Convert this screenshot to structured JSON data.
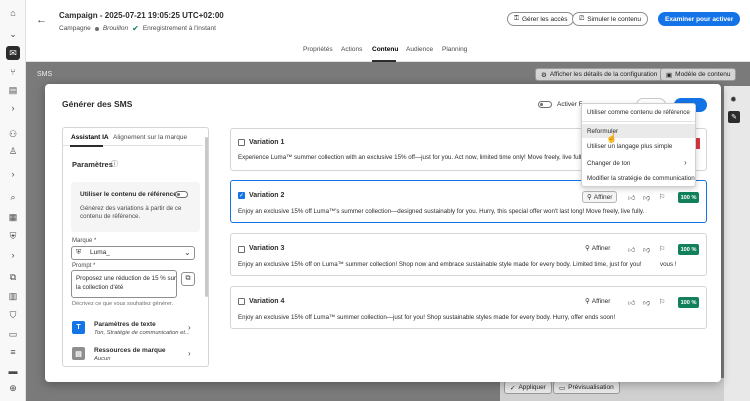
{
  "rail": {
    "icons": [
      "home-icon",
      "chevron-down-icon",
      "campaign-icon",
      "journey-icon",
      "content-icon",
      "chevron-right-icon",
      "audience-icon",
      "profile-icon",
      "chevron-right-icon",
      "schema-icon",
      "governance-icon",
      "datasets-icon",
      "queries-icon",
      "sources-icon",
      "policies-icon",
      "layers-icon",
      "monitoring-icon",
      "settings-icon"
    ]
  },
  "header": {
    "title": "Campaign - 2025-07-21 19:05:25 UTC+02:00",
    "type": "Campagne",
    "status": "Brouillon",
    "save_status": "Enregistrement à l'instant",
    "manage_access": "Gérer les accès",
    "simulate": "Simuler le contenu",
    "review_activate": "Examiner pour activer"
  },
  "tabs": [
    "Propriétés",
    "Actions",
    "Contenu",
    "Audience",
    "Planning"
  ],
  "active_tab": "Contenu",
  "channel_bar": {
    "label": "SMS",
    "show_config": "Afficher les détails de la configuration",
    "content_template": "Modèle de contenu"
  },
  "modal": {
    "title": "Générer des SMS",
    "toggle_label": "Activer F",
    "left_tabs": [
      "Assistant IA",
      "Alignement sur la marque"
    ],
    "params_title": "Paramètres",
    "use_ref_title": "Utiliser le contenu de référence",
    "use_ref_desc1": "Générez des variations à partir de ce",
    "use_ref_desc2": "contenu de référence.",
    "brand_label": "Marque *",
    "brand_value": "Luma_",
    "prompt_label": "Prompt *",
    "prompt_line1": "Proposez une réduction de 15 % sur",
    "prompt_line2": "la collection d'été",
    "prompt_hint": "Décrivez ce que vous souhaitez générer.",
    "text_params_title": "Paramètres de texte",
    "text_params_sub": "Ton, Stratégie de communication et...",
    "brand_res_title": "Ressources de marque",
    "brand_res_sub": "Aucun"
  },
  "variations": [
    {
      "title": "Variation 1",
      "text": "Experience Luma™ summer collection with an exclusive 15% off—just for you. Act now, limited time only! Move freely, live fully.",
      "checked": false,
      "score": "100 %"
    },
    {
      "title": "Variation 2",
      "text": "Enjoy an exclusive 15% off Luma™'s summer collection—designed sustainably for you. Hurry, this special offer won't last long! Move freely, live fully.",
      "checked": true,
      "score": "100 %"
    },
    {
      "title": "Variation 3",
      "text": "Enjoy an exclusive 15% off on Luma™ summer collection! Shop now and embrace sustainable style made for every body. Limited time, just for you!",
      "text_tail": "vous !",
      "checked": false,
      "score": "100 %"
    },
    {
      "title": "Variation 4",
      "text": "Enjoy an exclusive 15% off Luma™ summer collection—just for you! Shop sustainable styles made for every body. Hurry, offer ends soon!",
      "checked": false,
      "score": "100 %"
    }
  ],
  "refine_label": "Affiner",
  "menu": {
    "items": [
      "Utiliser comme contenu de référence",
      "Reformuler",
      "Utiliser un langage plus simple",
      "Changer de ton",
      "Modifier la stratégie de communication"
    ],
    "highlighted": "Reformuler"
  },
  "bottom": {
    "apply": "Appliquer",
    "preview": "Prévisualisation"
  },
  "colors": {
    "accent": "#1473e6",
    "score_green": "#12805c",
    "status_draft": "#6e6e6e",
    "status_saved": "#12805c"
  }
}
